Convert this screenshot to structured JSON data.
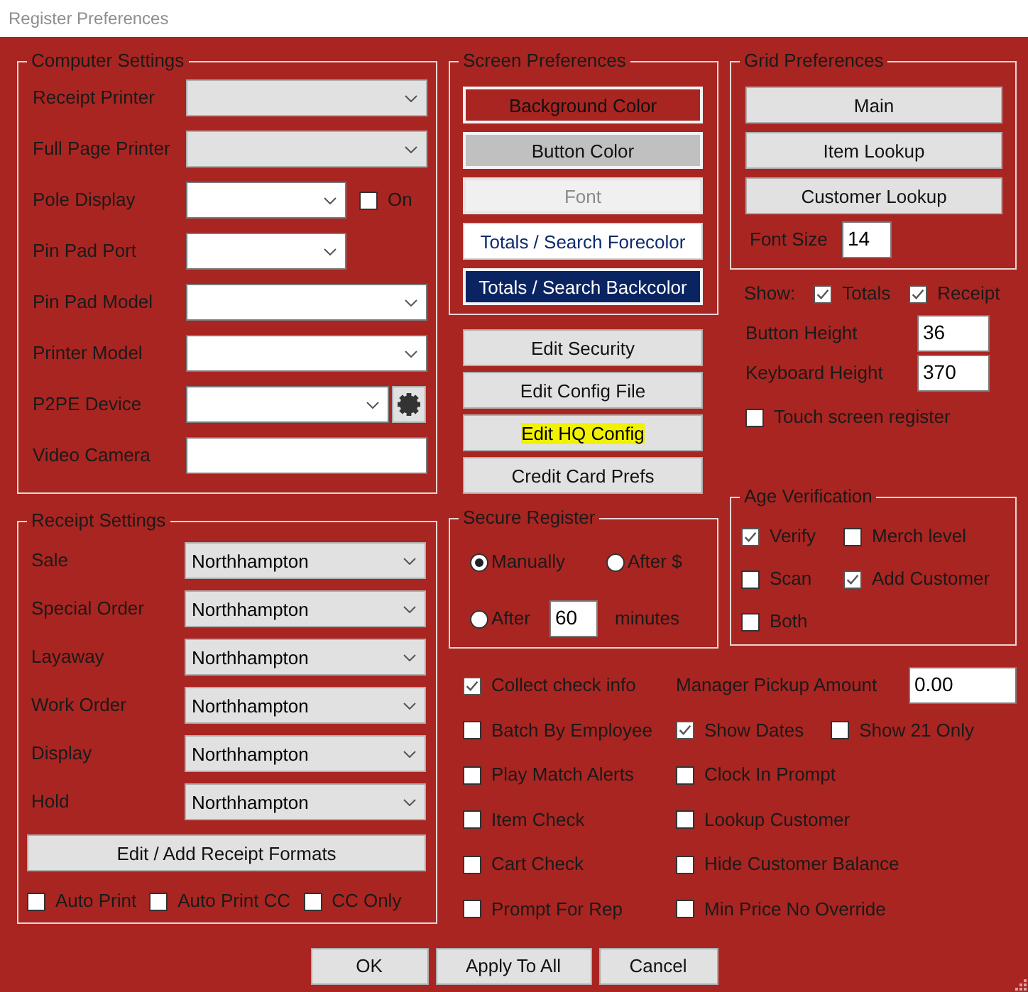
{
  "window": {
    "title": "Register Preferences"
  },
  "computer_settings": {
    "title": "Computer Settings",
    "fields": [
      {
        "label": "Receipt Printer",
        "kind": "list"
      },
      {
        "label": "Full Page Printer",
        "kind": "list"
      },
      {
        "label": "Pole Display",
        "kind": "short_combo",
        "option": {
          "label": "On",
          "checked": false
        }
      },
      {
        "label": "Pin Pad Port",
        "kind": "short_combo"
      },
      {
        "label": "Pin Pad Model",
        "kind": "combo"
      },
      {
        "label": "Printer Model",
        "kind": "combo"
      },
      {
        "label": "P2PE Device",
        "kind": "gear_combo"
      },
      {
        "label": "Video Camera",
        "kind": "text"
      }
    ]
  },
  "receipt_settings": {
    "title": "Receipt Settings",
    "fields": [
      {
        "label": "Sale",
        "value": "Northhampton"
      },
      {
        "label": "Special Order",
        "value": "Northhampton"
      },
      {
        "label": "Layaway",
        "value": "Northhampton"
      },
      {
        "label": "Work Order",
        "value": "Northhampton"
      },
      {
        "label": "Display",
        "value": "Northhampton"
      },
      {
        "label": "Hold",
        "value": "Northhampton"
      }
    ],
    "button": "Edit / Add Receipt Formats",
    "options": [
      {
        "label": "Auto Print",
        "checked": false
      },
      {
        "label": "Auto Print CC",
        "checked": false
      },
      {
        "label": "CC Only",
        "checked": false
      }
    ]
  },
  "screen_preferences": {
    "title": "Screen Preferences",
    "buttons": [
      {
        "label": "Background Color",
        "kind": "background"
      },
      {
        "label": "Button Color",
        "kind": "button"
      },
      {
        "label": "Font",
        "kind": "font"
      },
      {
        "label": "Totals / Search Forecolor",
        "kind": "forecolor"
      },
      {
        "label": "Totals / Search Backcolor",
        "kind": "backcolor"
      }
    ]
  },
  "edit_buttons": [
    {
      "label": "Edit Security",
      "highlighted": false
    },
    {
      "label": "Edit Config File",
      "highlighted": false
    },
    {
      "label": "Edit HQ Config",
      "highlighted": true
    },
    {
      "label": "Credit Card Prefs",
      "highlighted": false
    }
  ],
  "secure_register": {
    "title": "Secure Register",
    "modes": [
      {
        "label": "Manually",
        "selected": true
      },
      {
        "label": "After $",
        "selected": false
      },
      {
        "label": "After",
        "selected": false
      }
    ],
    "minutes": "60",
    "unit": "minutes"
  },
  "grid_preferences": {
    "title": "Grid Preferences",
    "buttons": [
      "Main",
      "Item Lookup",
      "Customer Lookup"
    ],
    "font_size": {
      "label": "Font Size",
      "value": "14"
    }
  },
  "show": {
    "label": "Show:",
    "options": [
      {
        "label": "Totals",
        "checked": true
      },
      {
        "label": "Receipt",
        "checked": true
      }
    ]
  },
  "heights": [
    {
      "label": "Button Height",
      "value": "36"
    },
    {
      "label": "Keyboard Height",
      "value": "370"
    }
  ],
  "touch_screen": {
    "label": "Touch screen register",
    "checked": false
  },
  "age_verification": {
    "title": "Age Verification",
    "options": [
      {
        "label": "Verify",
        "checked": true
      },
      {
        "label": "Merch level",
        "checked": false
      },
      {
        "label": "Scan",
        "checked": false
      },
      {
        "label": "Add Customer",
        "checked": true
      },
      {
        "label": "Both",
        "checked": false
      }
    ]
  },
  "options": [
    {
      "items": [
        {
          "kind": "checkbox",
          "label": "Collect check info",
          "checked": true
        },
        {
          "kind": "amount",
          "label": "Manager Pickup Amount",
          "value": "0.00"
        }
      ]
    },
    {
      "items": [
        {
          "kind": "checkbox",
          "label": "Batch By Employee",
          "checked": false
        },
        {
          "kind": "checkbox",
          "label": "Show Dates",
          "checked": true
        },
        {
          "kind": "checkbox",
          "label": "Show 21 Only",
          "checked": false
        }
      ]
    },
    {
      "items": [
        {
          "kind": "checkbox",
          "label": "Play Match Alerts",
          "checked": false
        },
        {
          "kind": "checkbox",
          "label": "Clock In Prompt",
          "checked": false
        }
      ]
    },
    {
      "items": [
        {
          "kind": "checkbox",
          "label": "Item Check",
          "checked": false
        },
        {
          "kind": "checkbox",
          "label": "Lookup Customer",
          "checked": false
        }
      ]
    },
    {
      "items": [
        {
          "kind": "checkbox",
          "label": "Cart Check",
          "checked": false
        },
        {
          "kind": "checkbox",
          "label": "Hide Customer Balance",
          "checked": false
        }
      ]
    },
    {
      "items": [
        {
          "kind": "checkbox",
          "label": "Prompt For Rep",
          "checked": false
        },
        {
          "kind": "checkbox",
          "label": "Min Price No Override",
          "checked": false
        }
      ]
    }
  ],
  "buttons": [
    "OK",
    "Apply To All",
    "Cancel"
  ]
}
